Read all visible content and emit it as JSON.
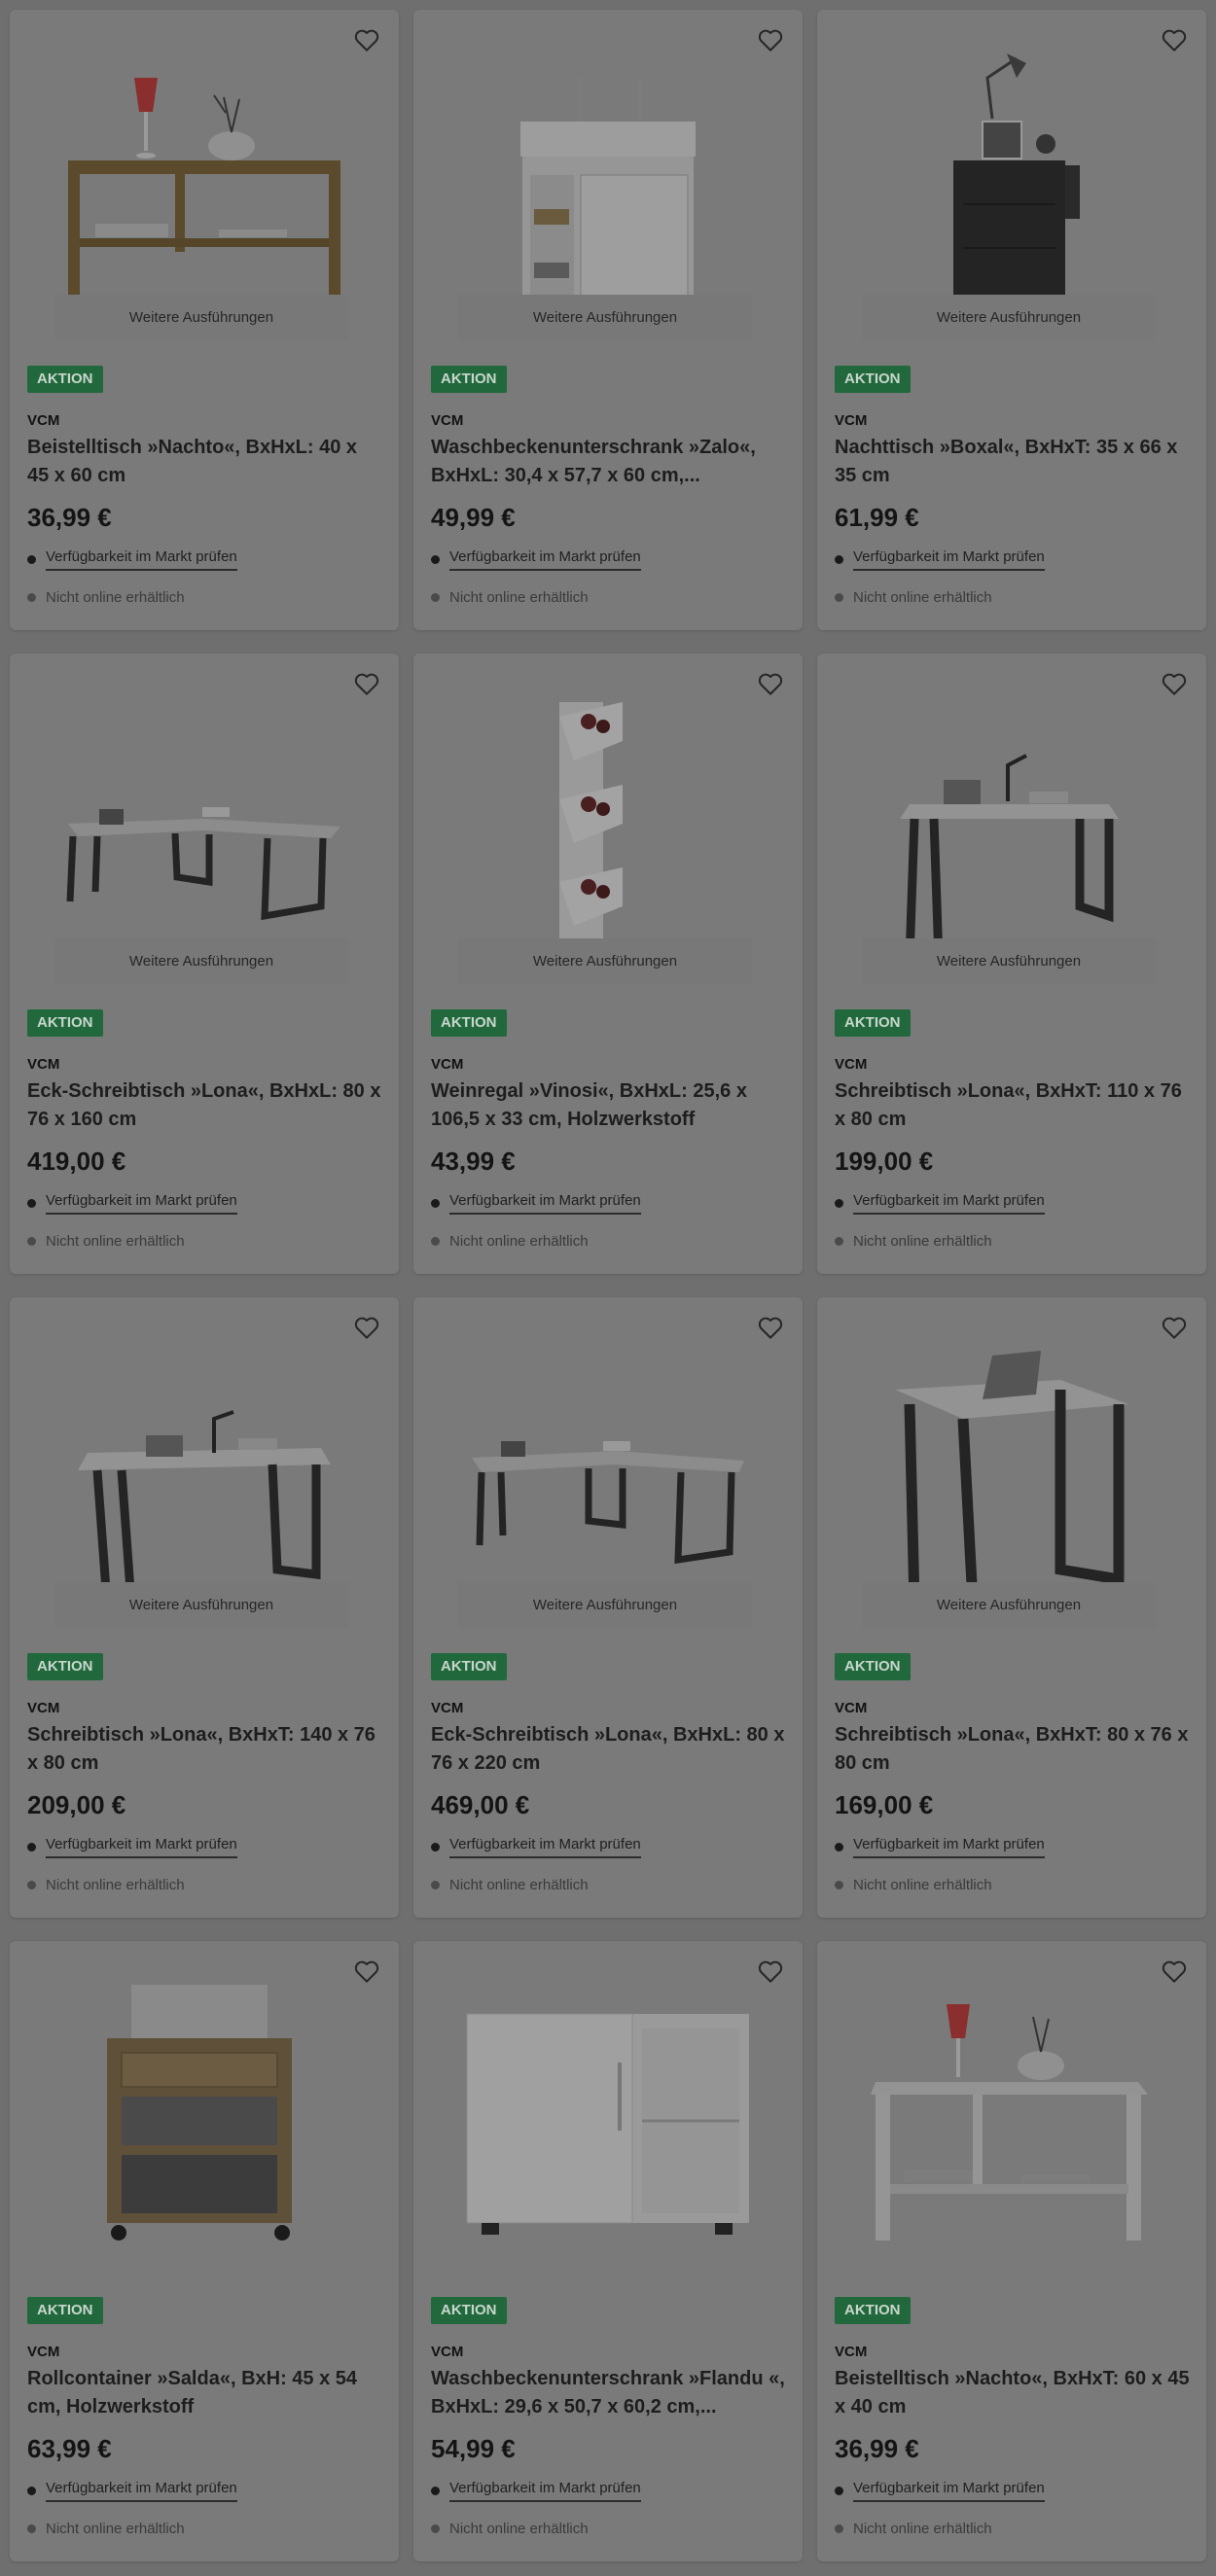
{
  "icons": {
    "wishlist": "heart-outline-icon",
    "availability": "dot-icon"
  },
  "colors": {
    "badge": "#21693c",
    "overlay": "#6f6f6f"
  },
  "products": [
    {
      "variants_label": "Weitere Ausführungen",
      "badge": "AKTION",
      "brand": "VCM",
      "title": "Beistelltisch »Nachto«, BxHxL: 40 x 45 x 60 cm",
      "price": "36,99 €",
      "availability": "Verfügbarkeit im Markt prüfen",
      "online": "Nicht online erhältlich"
    },
    {
      "variants_label": "Weitere Ausführungen",
      "badge": "AKTION",
      "brand": "VCM",
      "title": "Waschbeckenunterschrank »Zalo«, BxHxL: 30,4 x 57,7 x 60 cm,...",
      "price": "49,99 €",
      "availability": "Verfügbarkeit im Markt prüfen",
      "online": "Nicht online erhältlich"
    },
    {
      "variants_label": "Weitere Ausführungen",
      "badge": "AKTION",
      "brand": "VCM",
      "title": "Nachttisch »Boxal«, BxHxT: 35 x 66 x 35 cm",
      "price": "61,99 €",
      "availability": "Verfügbarkeit im Markt prüfen",
      "online": "Nicht online erhältlich"
    },
    {
      "variants_label": "Weitere Ausführungen",
      "badge": "AKTION",
      "brand": "VCM",
      "title": "Eck-Schreibtisch »Lona«, BxHxL: 80 x 76 x 160 cm",
      "price": "419,00 €",
      "availability": "Verfügbarkeit im Markt prüfen",
      "online": "Nicht online erhältlich"
    },
    {
      "variants_label": "Weitere Ausführungen",
      "badge": "AKTION",
      "brand": "VCM",
      "title": "Weinregal »Vinosi«, BxHxL: 25,6 x 106,5 x 33 cm, Holzwerkstoff",
      "price": "43,99 €",
      "availability": "Verfügbarkeit im Markt prüfen",
      "online": "Nicht online erhältlich"
    },
    {
      "variants_label": "Weitere Ausführungen",
      "badge": "AKTION",
      "brand": "VCM",
      "title": "Schreibtisch »Lona«, BxHxT: 110 x 76 x 80 cm",
      "price": "199,00 €",
      "availability": "Verfügbarkeit im Markt prüfen",
      "online": "Nicht online erhältlich"
    },
    {
      "variants_label": "Weitere Ausführungen",
      "badge": "AKTION",
      "brand": "VCM",
      "title": "Schreibtisch »Lona«, BxHxT: 140 x 76 x 80 cm",
      "price": "209,00 €",
      "availability": "Verfügbarkeit im Markt prüfen",
      "online": "Nicht online erhältlich"
    },
    {
      "variants_label": "Weitere Ausführungen",
      "badge": "AKTION",
      "brand": "VCM",
      "title": "Eck-Schreibtisch »Lona«, BxHxL: 80 x 76 x 220 cm",
      "price": "469,00 €",
      "availability": "Verfügbarkeit im Markt prüfen",
      "online": "Nicht online erhältlich"
    },
    {
      "variants_label": "Weitere Ausführungen",
      "badge": "AKTION",
      "brand": "VCM",
      "title": "Schreibtisch »Lona«, BxHxT: 80 x 76 x 80 cm",
      "price": "169,00 €",
      "availability": "Verfügbarkeit im Markt prüfen",
      "online": "Nicht online erhältlich"
    },
    {
      "variants_label": "",
      "badge": "AKTION",
      "brand": "VCM",
      "title": "Rollcontainer »Salda«, BxH: 45 x 54 cm, Holzwerkstoff",
      "price": "63,99 €",
      "availability": "Verfügbarkeit im Markt prüfen",
      "online": "Nicht online erhältlich"
    },
    {
      "variants_label": "",
      "badge": "AKTION",
      "brand": "VCM",
      "title": "Waschbeckenunterschrank »Flandu «, BxHxL: 29,6 x 50,7 x 60,2 cm,...",
      "price": "54,99 €",
      "availability": "Verfügbarkeit im Markt prüfen",
      "online": "Nicht online erhältlich"
    },
    {
      "variants_label": "",
      "badge": "AKTION",
      "brand": "VCM",
      "title": "Beistelltisch »Nachto«, BxHxT: 60 x 45 x 40 cm",
      "price": "36,99 €",
      "availability": "Verfügbarkeit im Markt prüfen",
      "online": "Nicht online erhältlich"
    }
  ]
}
